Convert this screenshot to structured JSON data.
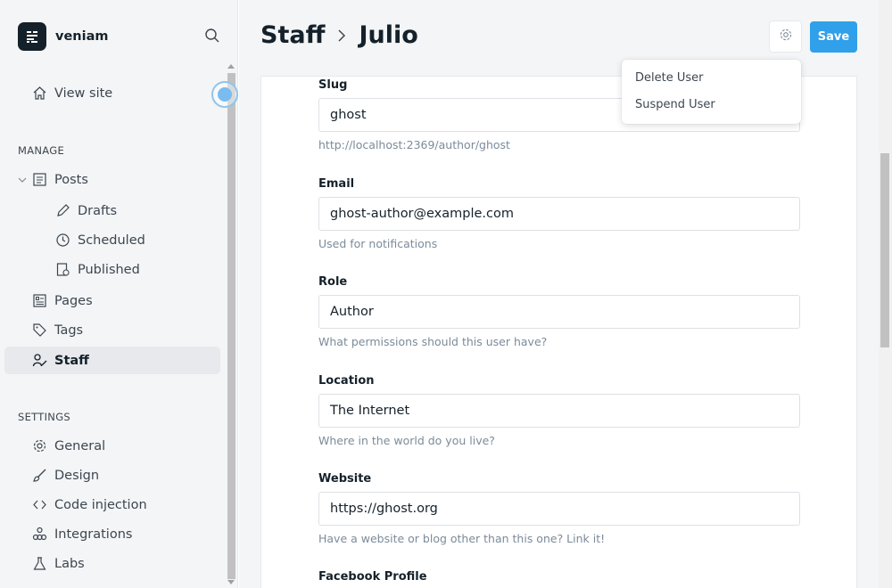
{
  "brand": {
    "name": "veniam",
    "icon": "ghost-logo-icon"
  },
  "sidebar": {
    "view_site": "View site",
    "manage_header": "MANAGE",
    "posts": "Posts",
    "drafts": "Drafts",
    "scheduled": "Scheduled",
    "published": "Published",
    "pages": "Pages",
    "tags": "Tags",
    "staff": "Staff",
    "settings_header": "SETTINGS",
    "general": "General",
    "design": "Design",
    "code_injection": "Code injection",
    "integrations": "Integrations",
    "labs": "Labs"
  },
  "header": {
    "breadcrumb_parent": "Staff",
    "breadcrumb_current": "Julio",
    "save_label": "Save"
  },
  "menu": {
    "delete_user": "Delete User",
    "suspend_user": "Suspend User"
  },
  "form": {
    "slug_label": "Slug",
    "slug_value": "ghost",
    "slug_hint": "http://localhost:2369/author/ghost",
    "email_label": "Email",
    "email_value": "ghost-author@example.com",
    "email_hint": "Used for notifications",
    "role_label": "Role",
    "role_value": "Author",
    "role_hint": "What permissions should this user have?",
    "location_label": "Location",
    "location_value": "The Internet",
    "location_hint": "Where in the world do you live?",
    "website_label": "Website",
    "website_value": "https://ghost.org",
    "website_hint": "Have a website or blog other than this one? Link it!",
    "facebook_label": "Facebook Profile"
  },
  "colors": {
    "accent": "#30a0ea",
    "text": "#15212a",
    "hint": "#7c8b9a"
  }
}
